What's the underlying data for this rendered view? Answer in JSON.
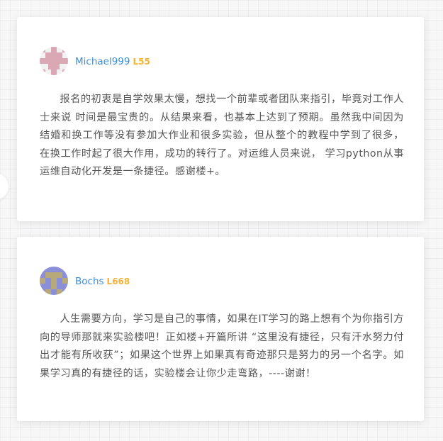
{
  "testimonials": [
    {
      "username": "Michael999",
      "level": "L55",
      "avatar": {
        "fg": "#d9a8b4",
        "bg": "#f2f2f2"
      },
      "text": "报名的初衷是自学效果太慢，想找一个前辈或者团队来指引，毕竟对工作人士来说 时间是最宝贵的。从结果来看，也基本上达到了预期。虽然我中间因为结婚和换工作等没有参加大作业和很多实验，但从整个的教程中学到了很多， 在换工作时起了很大作用，成功的转行了。对运维人员来说， 学习python从事运维自动化开发是一条捷径。感谢楼+。"
    },
    {
      "username": "Bochs",
      "level": "L668",
      "avatar": {
        "fg": "#b8a97a",
        "bg": "#8a8fd8"
      },
      "text": "人生需要方向，学习是自己的事情，如果在IT学习的路上想有个为你指引方向的导师那就来实验楼吧！正如楼+开篇所讲 “这里没有捷径，只有汗水努力付出才能有所收获”；如果这个世界上如果真有奇迹那只是努力的另一个名字。如果学习真的有捷径的话，实验楼会让你少走弯路，----谢谢！"
    }
  ]
}
